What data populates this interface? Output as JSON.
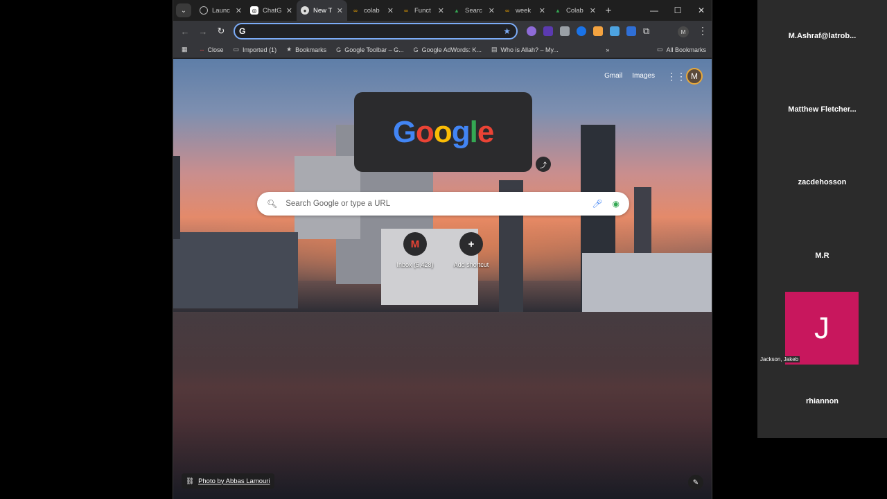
{
  "browser": {
    "tabs": [
      {
        "label": "Launc",
        "icon": "globe-icon",
        "active": false
      },
      {
        "label": "ChatG",
        "icon": "chatgpt-icon",
        "active": false
      },
      {
        "label": "New T",
        "icon": "chrome-icon",
        "active": true
      },
      {
        "label": "colab",
        "icon": "colab-icon",
        "active": false
      },
      {
        "label": "Funct",
        "icon": "colab-icon",
        "active": false
      },
      {
        "label": "Searc",
        "icon": "drive-icon",
        "active": false
      },
      {
        "label": "week",
        "icon": "colab-icon",
        "active": false
      },
      {
        "label": "Colab",
        "icon": "drive-icon",
        "active": false
      }
    ],
    "omnibox": {
      "value": "",
      "placeholder": ""
    },
    "bookmarks": [
      {
        "label": "Close",
        "icon": "dash-icon"
      },
      {
        "label": "Imported (1)",
        "icon": "folder-icon"
      },
      {
        "label": "Bookmarks",
        "icon": "star-icon"
      },
      {
        "label": "Google Toolbar – G...",
        "icon": "google-icon"
      },
      {
        "label": "Google AdWords: K...",
        "icon": "google-icon"
      },
      {
        "label": "Who is Allah? – My...",
        "icon": "page-icon"
      }
    ],
    "all_bookmarks": "All Bookmarks",
    "profile_initial": "M"
  },
  "ntp": {
    "gmail": "Gmail",
    "images": "Images",
    "avatar_initial": "M",
    "doodle_text": "Google",
    "search_placeholder": "Search Google or type a URL",
    "shortcuts": [
      {
        "label": "Inbox (5,428)",
        "icon": "gmail-icon",
        "glyph": "M"
      },
      {
        "label": "Add shortcut",
        "icon": "plus-icon",
        "glyph": "+"
      }
    ],
    "photo_credit": "Photo by Abbas Lamouri"
  },
  "participants": [
    {
      "name": "M.Ashraf@latrob..."
    },
    {
      "name": "Matthew  Fletcher..."
    },
    {
      "name": "zacdehosson"
    },
    {
      "name": "M.R"
    },
    {
      "name": "Jackson, Jakeb",
      "tile_initial": "J",
      "tile_color": "#c8175d"
    },
    {
      "name": "rhiannon"
    }
  ],
  "colors": {
    "accent": "#7cacf8",
    "tile": "#c8175d"
  }
}
